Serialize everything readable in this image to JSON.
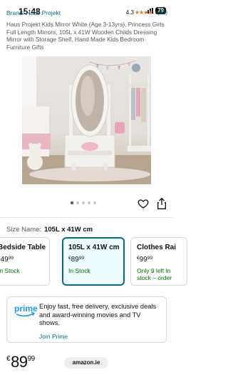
{
  "status_bar": {
    "time": "15:48",
    "battery": "79"
  },
  "header": {
    "brand_link": "Brand: Haus Projekt",
    "rating": "4.3",
    "stars": "★★★★☆",
    "rating_count": "(83)"
  },
  "product": {
    "title": "Haus Projekt Kids Mirror White (Age 3-13yrs), Princess Girls Full Length Mirrors, 105L x 41W Wooden Childs Dressing Mirror with Storage Shelf, Hand Made Kids Bedroom Furniture Gifts"
  },
  "gallery": {
    "image_count": 5,
    "active_index": 0
  },
  "size": {
    "label": "Size Name:",
    "value": "105L x 41W cm"
  },
  "options": [
    {
      "name": "Bedside Table",
      "currency": "€",
      "price_whole": "49",
      "price_frac": "99",
      "stock": "In Stock",
      "stock_line2": "",
      "selected": false
    },
    {
      "name": "105L x 41W cm",
      "currency": "€",
      "price_whole": "89",
      "price_frac": "99",
      "stock": "In Stock",
      "stock_line2": "",
      "selected": true
    },
    {
      "name": "Clothes Rai",
      "currency": "€",
      "price_whole": "99",
      "price_frac": "99",
      "stock": "Only 9 left in",
      "stock_line2": "stock – order",
      "selected": false
    }
  ],
  "prime": {
    "logo": "prime",
    "text": "Enjoy fast, free delivery, exclusive deals and award-winning movies and TV shows.",
    "join": "Join Prime"
  },
  "bottom": {
    "currency": "€",
    "price_whole": "89",
    "price_frac": "99",
    "url": "amazon.ie"
  },
  "colors": {
    "link": "#007185",
    "stock": "#007600",
    "star": "#de7921",
    "prime": "#1a98ff",
    "selected_border": "#007185"
  }
}
